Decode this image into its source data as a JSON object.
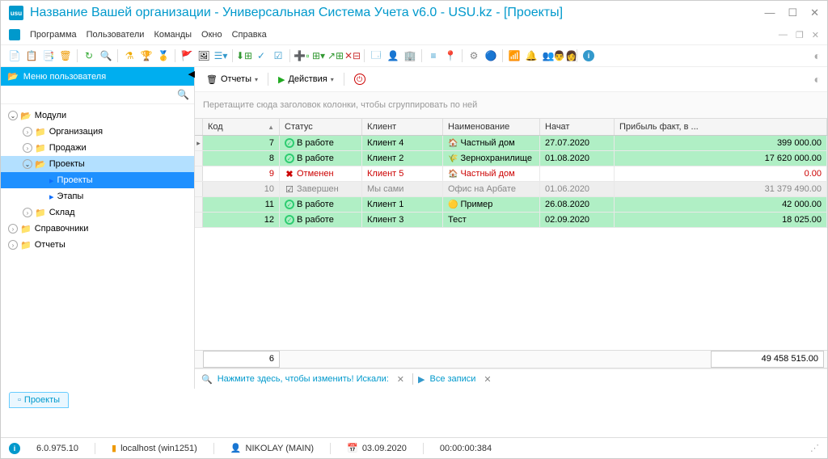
{
  "window": {
    "title": "Название Вашей организации - Универсальная Система Учета v6.0 - USU.kz - [Проекты]"
  },
  "menu": {
    "items": [
      "Программа",
      "Пользователи",
      "Команды",
      "Окно",
      "Справка"
    ]
  },
  "sidebar": {
    "title": "Меню пользователя",
    "tree": [
      {
        "label": "Модули",
        "level": 0,
        "expanded": true,
        "arrow": true
      },
      {
        "label": "Организация",
        "level": 1,
        "expanded": false,
        "arrow": true
      },
      {
        "label": "Продажи",
        "level": 1,
        "expanded": false,
        "arrow": true
      },
      {
        "label": "Проекты",
        "level": 1,
        "expanded": true,
        "arrow": true,
        "activeParent": true
      },
      {
        "label": "Проекты",
        "level": 2,
        "selected": true,
        "blue": true
      },
      {
        "label": "Этапы",
        "level": 2,
        "blue": true
      },
      {
        "label": "Склад",
        "level": 1,
        "expanded": false,
        "arrow": true
      },
      {
        "label": "Справочники",
        "level": 0,
        "expanded": false,
        "arrow": true
      },
      {
        "label": "Отчеты",
        "level": 0,
        "expanded": false,
        "arrow": true
      }
    ]
  },
  "contentToolbar": {
    "reports": "Отчеты",
    "actions": "Действия"
  },
  "groupHint": "Перетащите сюда заголовок колонки, чтобы сгруппировать по ней",
  "grid": {
    "columns": {
      "code": "Код",
      "status": "Статус",
      "client": "Клиент",
      "name": "Наименование",
      "date": "Начат",
      "profit": "Прибыль факт, в ..."
    },
    "rows": [
      {
        "marker": true,
        "code": "7",
        "status": "В работе",
        "statusType": "work",
        "client": "Клиент 4",
        "name": "Частный дом",
        "nameIcon": "🏠",
        "nameIconColor": "#c00",
        "date": "27.07.2020",
        "profit": "399 000.00",
        "rowClass": "green"
      },
      {
        "code": "8",
        "status": "В работе",
        "statusType": "work",
        "client": "Клиент 2",
        "name": "Зернохранилище",
        "nameIcon": "🌾",
        "nameIconColor": "#c00",
        "date": "01.08.2020",
        "profit": "17 620 000.00",
        "rowClass": "green"
      },
      {
        "code": "9",
        "status": "Отменен",
        "statusType": "cancel",
        "client": "Клиент 5",
        "name": "Частный дом",
        "nameIcon": "🏠",
        "nameIconColor": "#c00",
        "date": "",
        "profit": "0.00",
        "rowClass": "white",
        "red": true
      },
      {
        "code": "10",
        "status": "Завершен",
        "statusType": "done",
        "client": "Мы сами",
        "name": "Офис на Арбате",
        "nameIcon": "",
        "date": "01.06.2020",
        "profit": "31 379 490.00",
        "rowClass": "gray"
      },
      {
        "code": "11",
        "status": "В работе",
        "statusType": "work",
        "client": "Клиент 1",
        "name": "Пример",
        "nameIcon": "🟡",
        "date": "26.08.2020",
        "profit": "42 000.00",
        "rowClass": "green"
      },
      {
        "code": "12",
        "status": "В работе",
        "statusType": "work",
        "client": "Клиент 3",
        "name": "Тест",
        "nameIcon": "",
        "date": "02.09.2020",
        "profit": "18 025.00",
        "rowClass": "green"
      }
    ],
    "footer": {
      "count": "6",
      "totalProfit": "49 458 515.00"
    }
  },
  "filterBar": {
    "text1": "Нажмите здесь, чтобы изменить! Искали:",
    "text2": "Все записи"
  },
  "bottomTab": {
    "label": "Проекты"
  },
  "status": {
    "version": "6.0.975.10",
    "host": "localhost (win1251)",
    "user": "NIKOLAY (MAIN)",
    "date": "03.09.2020",
    "time": "00:00:00:384"
  }
}
